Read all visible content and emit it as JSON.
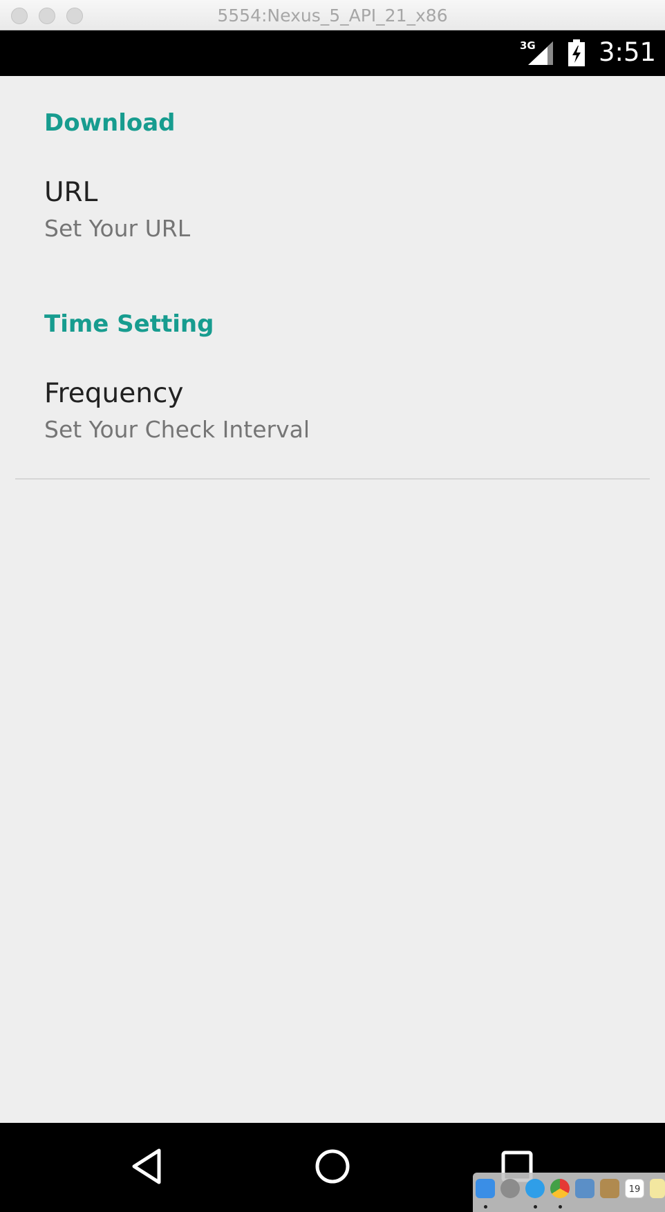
{
  "window": {
    "title": "5554:Nexus_5_API_21_x86"
  },
  "status_bar": {
    "network": "3G",
    "time": "3:51"
  },
  "settings": {
    "download_category": "Download",
    "url_title": "URL",
    "url_summary": "Set Your URL",
    "time_category": "Time Setting",
    "frequency_title": "Frequency",
    "frequency_summary": "Set Your Check Interval"
  },
  "dock": {
    "calendar_day": "19"
  },
  "colors": {
    "accent": "#179c8f",
    "background": "#eeeeee",
    "bars": "#000000"
  }
}
